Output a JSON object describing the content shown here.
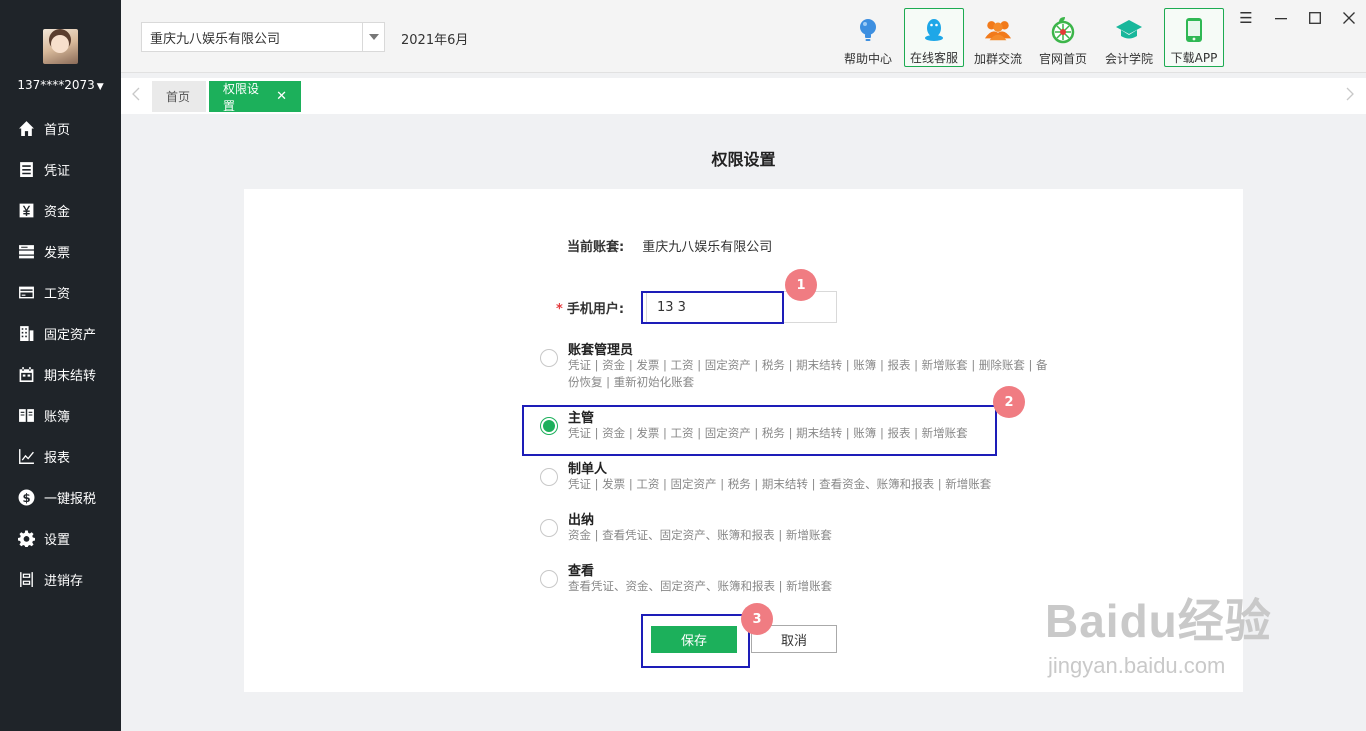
{
  "sidebar": {
    "username": "137****2073",
    "items": [
      {
        "label": "首页",
        "icon": "home-icon"
      },
      {
        "label": "凭证",
        "icon": "document-icon"
      },
      {
        "label": "资金",
        "icon": "yuan-icon"
      },
      {
        "label": "发票",
        "icon": "invoice-icon"
      },
      {
        "label": "工资",
        "icon": "card-icon"
      },
      {
        "label": "固定资产",
        "icon": "building-icon"
      },
      {
        "label": "期末结转",
        "icon": "calendar-icon"
      },
      {
        "label": "账簿",
        "icon": "book-icon"
      },
      {
        "label": "报表",
        "icon": "chart-icon"
      },
      {
        "label": "一键报税",
        "icon": "dollar-icon"
      },
      {
        "label": "设置",
        "icon": "gear-icon"
      },
      {
        "label": "进销存",
        "icon": "inventory-icon"
      }
    ]
  },
  "topbar": {
    "company": "重庆九八娱乐有限公司",
    "period": "2021年6月",
    "tools": [
      {
        "label": "帮助中心",
        "icon": "lightbulb-icon"
      },
      {
        "label": "在线客服",
        "icon": "qq-penguin-icon"
      },
      {
        "label": "加群交流",
        "icon": "group-icon"
      },
      {
        "label": "官网首页",
        "icon": "leaf-globe-icon"
      },
      {
        "label": "会计学院",
        "icon": "graduation-cap-icon"
      },
      {
        "label": "下载APP",
        "icon": "phone-icon"
      }
    ]
  },
  "tabs": {
    "home": "首页",
    "active": "权限设置",
    "close": "✕"
  },
  "page": {
    "title": "权限设置",
    "account_label": "当前账套:",
    "account_value": "重庆九八娱乐有限公司",
    "phone_label": "手机用户:",
    "phone_required": "*",
    "phone_value": "13          3"
  },
  "roles": [
    {
      "name": "账套管理员",
      "desc": "凭证 | 资金 | 发票 | 工资 | 固定资产 | 税务 | 期末结转 | 账簿 | 报表 | 新增账套 | 删除账套 | 备份恢复 | 重新初始化账套",
      "checked": false
    },
    {
      "name": "主管",
      "desc": "凭证 | 资金 | 发票 | 工资 | 固定资产 | 税务 | 期末结转 | 账簿 | 报表 | 新增账套",
      "checked": true
    },
    {
      "name": "制单人",
      "desc": "凭证 | 发票 | 工资 | 固定资产 | 税务 | 期末结转 | 查看资金、账簿和报表 | 新增账套",
      "checked": false
    },
    {
      "name": "出纳",
      "desc": "资金 | 查看凭证、固定资产、账簿和报表 | 新增账套",
      "checked": false
    },
    {
      "name": "查看",
      "desc": "查看凭证、资金、固定资产、账簿和报表 | 新增账套",
      "checked": false
    }
  ],
  "buttons": {
    "save": "保存",
    "cancel": "取消"
  },
  "annotations": [
    "1",
    "2",
    "3"
  ],
  "watermark": {
    "line1": "Baidu经验",
    "line2": "jingyan.baidu.com"
  },
  "colors": {
    "accent": "#1cb05b",
    "sidebar_bg": "#1f2429",
    "highlight": "#1d1db8",
    "badge": "#f07c82"
  }
}
